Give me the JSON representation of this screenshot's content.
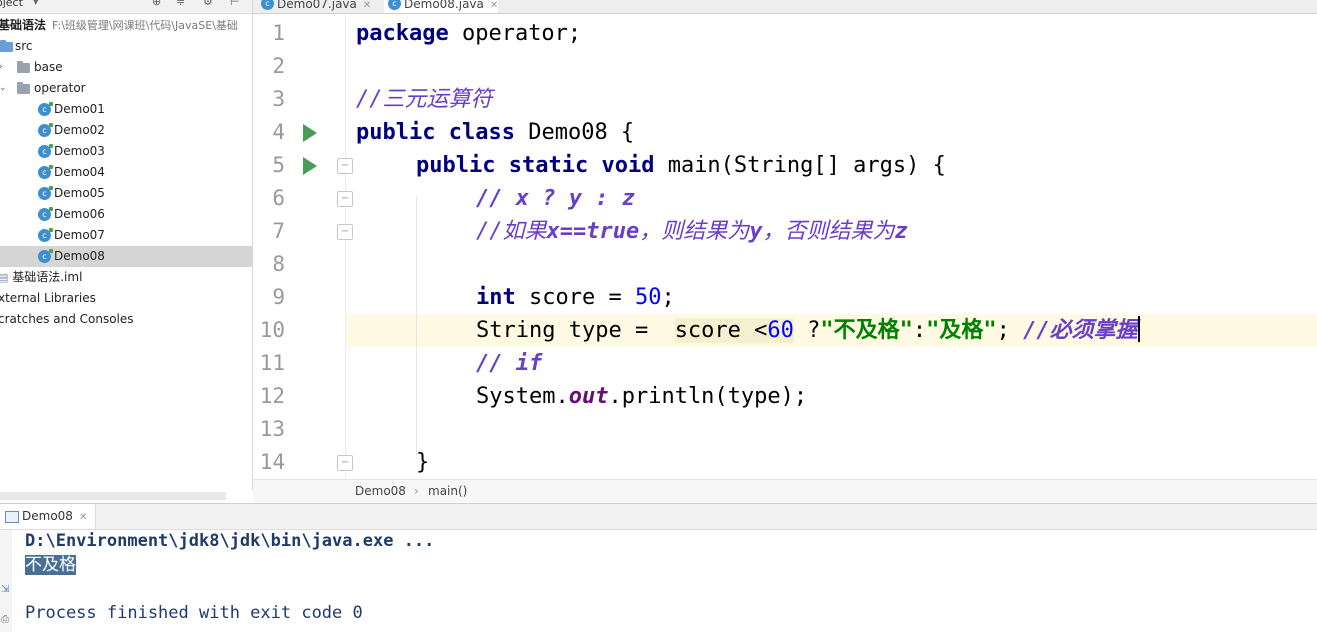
{
  "project": {
    "header_label": "oject",
    "root_label": "基础语法",
    "root_path": "F:\\班级管理\\网课班\\代码\\JavaSE\\基础",
    "items": [
      {
        "label": "src"
      },
      {
        "label": "base"
      },
      {
        "label": "operator"
      },
      {
        "label": "Demo01"
      },
      {
        "label": "Demo02"
      },
      {
        "label": "Demo03"
      },
      {
        "label": "Demo04"
      },
      {
        "label": "Demo05"
      },
      {
        "label": "Demo06"
      },
      {
        "label": "Demo07"
      },
      {
        "label": "Demo08"
      },
      {
        "label": "基础语法.iml"
      },
      {
        "label": "xternal Libraries"
      },
      {
        "label": "cratches and Consoles"
      }
    ],
    "selected": "Demo08"
  },
  "tabs": [
    {
      "label": "Demo07.java",
      "icon": "class-icon"
    },
    {
      "label": "Demo08.java",
      "icon": "class-icon",
      "active": true
    }
  ],
  "editor": {
    "lines": [
      {
        "n": "1",
        "code": "package operator;"
      },
      {
        "n": "2",
        "code": ""
      },
      {
        "n": "3",
        "code": "//三元运算符"
      },
      {
        "n": "4",
        "code": "public class Demo08 {"
      },
      {
        "n": "5",
        "code": "public static void main(String[] args) {"
      },
      {
        "n": "6",
        "code": "// x ? y : z"
      },
      {
        "n": "7",
        "code": "//如果x==true，则结果为y，否则结果为z"
      },
      {
        "n": "8",
        "code": ""
      },
      {
        "n": "9",
        "code": "int score = 50;"
      },
      {
        "n": "10",
        "code": "String type = score <60 ?\"不及格\":\"及格\"; //必须掌握"
      },
      {
        "n": "11",
        "code": "// if"
      },
      {
        "n": "12",
        "code": "System.out.println(type);"
      },
      {
        "n": "13",
        "code": ""
      },
      {
        "n": "14",
        "code": "}"
      }
    ],
    "current_line": 10,
    "tokens": {
      "package": "package",
      "pkg_name": " operator;",
      "comment3": "//三元运算符",
      "public": "public",
      "class": "class",
      "class_name": " Demo08 {",
      "static": "static",
      "void": "void",
      "main_sig": " main(String[] args) {",
      "comment6": "// x ? y : z",
      "comment7_a": "//如果",
      "comment7_b": "x==true",
      "comment7_c": "，则结果为",
      "comment7_d": "y",
      "comment7_e": "，否则结果为",
      "comment7_f": "z",
      "int": "int",
      "score_decl": " score = ",
      "score_val": "50",
      "semi": ";",
      "string_decl": "String type =  ",
      "cond": "score <",
      "cond_val": "60",
      "qmark": " ?",
      "str1": "\"不及格\"",
      "colon": ":",
      "str2": "\"及格\"",
      "semi2": "; ",
      "comment10": "//必须掌握",
      "comment11": "// if",
      "sys": "System.",
      "out": "out",
      "println": ".println(type);",
      "close": "}"
    }
  },
  "breadcrumb": {
    "class": "Demo08",
    "method": "main()"
  },
  "run": {
    "tab_label": "Demo08",
    "console": [
      "D:\\Environment\\jdk8\\jdk\\bin\\java.exe ...",
      "不及格",
      "",
      "Process finished with exit code 0"
    ]
  },
  "colors": {
    "keyword": "#000080",
    "comment": "#6a3ec8",
    "number": "#0000ff",
    "string": "#008000",
    "current_line": "#fffae3",
    "run_icon": "#499c54"
  }
}
